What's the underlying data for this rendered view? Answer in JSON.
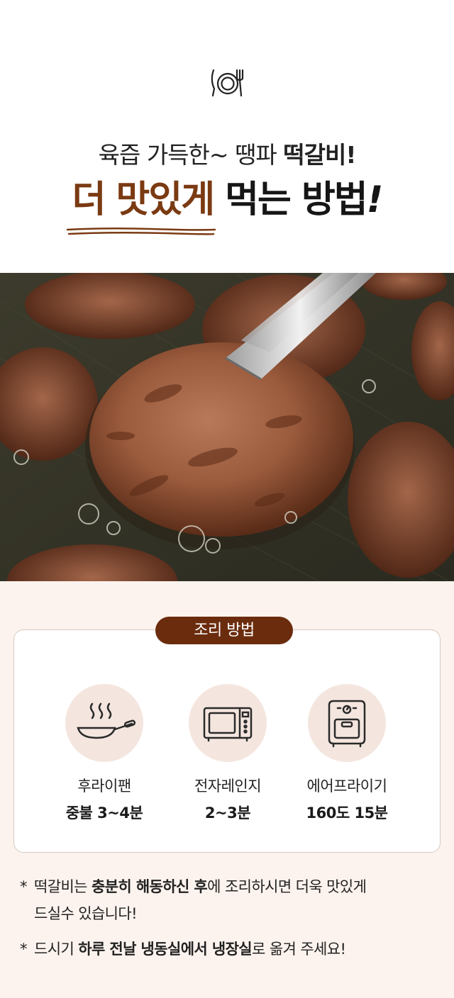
{
  "header": {
    "icon": "plate-fork-knife-icon",
    "subtitle_plain": "육즙 가득한~ 땡파 ",
    "subtitle_bold": "떡갈비!",
    "title_accent": "더 맛있게",
    "title_rest": " 먹는 방법",
    "title_exclaim": "!",
    "accent_color": "#7a3a12"
  },
  "photo": {
    "subject": "grilled tteokgalbi patties in a pan with tongs"
  },
  "cooking": {
    "badge": "조리 방법",
    "badge_color": "#6b2c0e",
    "methods": [
      {
        "icon": "frying-pan-icon",
        "name": "후라이팬",
        "detail": "중불 3~4분"
      },
      {
        "icon": "microwave-icon",
        "name": "전자레인지",
        "detail": "2~3분"
      },
      {
        "icon": "air-fryer-icon",
        "name": "에어프라이기",
        "detail": "160도 15분"
      }
    ]
  },
  "notes": {
    "star": "*",
    "note1_a": "떡갈비는 ",
    "note1_b": "충분히 해동하신 후",
    "note1_c": "에 조리하시면 더욱 맛있게",
    "note1_d": "드실수 있습니다!",
    "note2_a": "드시기 ",
    "note2_b": "하루 전날 냉동실에서 냉장실",
    "note2_c": "로 옮겨 주세요!"
  }
}
